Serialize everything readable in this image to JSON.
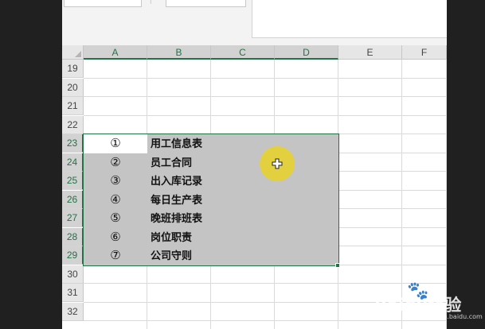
{
  "formula_bar": {
    "name_box_value": "",
    "function_box_value": ""
  },
  "columns": [
    {
      "label": "A",
      "selected": true
    },
    {
      "label": "B",
      "selected": true
    },
    {
      "label": "C",
      "selected": true
    },
    {
      "label": "D",
      "selected": true
    },
    {
      "label": "E",
      "selected": false
    },
    {
      "label": "F",
      "selected": false
    }
  ],
  "rows": [
    {
      "label": "19",
      "selected": false
    },
    {
      "label": "20",
      "selected": false
    },
    {
      "label": "21",
      "selected": false
    },
    {
      "label": "22",
      "selected": false
    },
    {
      "label": "23",
      "selected": true
    },
    {
      "label": "24",
      "selected": true
    },
    {
      "label": "25",
      "selected": true
    },
    {
      "label": "26",
      "selected": true
    },
    {
      "label": "27",
      "selected": true
    },
    {
      "label": "28",
      "selected": true
    },
    {
      "label": "29",
      "selected": true
    },
    {
      "label": "30",
      "selected": false
    },
    {
      "label": "31",
      "selected": false
    },
    {
      "label": "32",
      "selected": false
    }
  ],
  "cells": [
    {
      "ref": "A23",
      "num": "①",
      "text": "用工信息表"
    },
    {
      "ref": "A24",
      "num": "②",
      "text": "员工合同"
    },
    {
      "ref": "A25",
      "num": "③",
      "text": "出入库记录"
    },
    {
      "ref": "A26",
      "num": "④",
      "text": "每日生产表"
    },
    {
      "ref": "A27",
      "num": "⑤",
      "text": "晚班排班表"
    },
    {
      "ref": "A28",
      "num": "⑥",
      "text": "岗位职责"
    },
    {
      "ref": "A29",
      "num": "⑦",
      "text": "公司守则"
    }
  ],
  "selection": {
    "range": "A23:D29",
    "border_color": "#217346",
    "fill_color": "#c4c4c4"
  },
  "cursor": {
    "icon": "cross-cursor-icon",
    "highlight_color": "#e8d228"
  },
  "watermark": {
    "text": "Baidu经验",
    "url": "jingyan.baidu.com"
  },
  "colors": {
    "accent": "#217346",
    "header_bg": "#e6e6e6",
    "frame_bg": "#202020"
  }
}
